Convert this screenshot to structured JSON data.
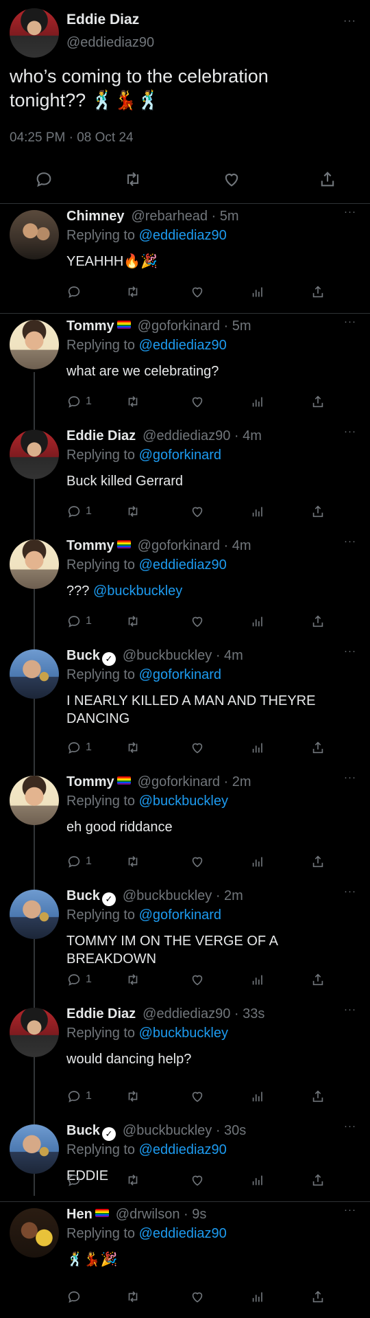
{
  "main": {
    "name": "Eddie Diaz",
    "handle": "@eddiediaz90",
    "text": "who’s coming to the celebration tonight?? 🕺💃🕺",
    "timestamp": "04:25 PM · 08 Oct 24",
    "more": "···"
  },
  "replies": [
    {
      "name": "Chimney",
      "badge": "",
      "handle": "@rebarhead · 5m",
      "replying_label": "Replying to",
      "replying_to": "@eddiediaz90",
      "text": "YEAHHH🔥🎉",
      "mention": "",
      "reply_count": ""
    },
    {
      "name": "Tommy",
      "badge": "flag",
      "handle": "@goforkinard · 5m",
      "replying_label": "Replying to",
      "replying_to": "@eddiediaz90",
      "text": "what are we celebrating?",
      "mention": "",
      "reply_count": "1"
    },
    {
      "name": "Eddie Diaz",
      "badge": "",
      "handle": "@eddiediaz90 · 4m",
      "replying_label": "Replying to",
      "replying_to": "@goforkinard",
      "text": "Buck killed Gerrard",
      "mention": "",
      "reply_count": "1"
    },
    {
      "name": "Tommy",
      "badge": "flag",
      "handle": "@goforkinard · 4m",
      "replying_label": "Replying to",
      "replying_to": "@eddiediaz90",
      "text": "???",
      "mention": "@buckbuckley",
      "reply_count": "1"
    },
    {
      "name": "Buck",
      "badge": "verified",
      "handle": "@buckbuckley · 4m",
      "replying_label": "Replying to",
      "replying_to": "@goforkinard",
      "text": "I NEARLY KILLED A MAN AND THEYRE DANCING",
      "mention": "",
      "reply_count": "1"
    },
    {
      "name": "Tommy",
      "badge": "flag",
      "handle": "@goforkinard · 2m",
      "replying_label": "Replying to",
      "replying_to": "@buckbuckley",
      "text": "eh good riddance",
      "mention": "",
      "reply_count": "1"
    },
    {
      "name": "Buck",
      "badge": "verified",
      "handle": "@buckbuckley · 2m",
      "replying_label": "Replying to",
      "replying_to": "@goforkinard",
      "text": "TOMMY IM ON THE VERGE OF A BREAKDOWN",
      "mention": "",
      "reply_count": "1"
    },
    {
      "name": "Eddie Diaz",
      "badge": "",
      "handle": "@eddiediaz90 · 33s",
      "replying_label": "Replying to",
      "replying_to": "@buckbuckley",
      "text": "would dancing help?",
      "mention": "",
      "reply_count": "1"
    },
    {
      "name": "Buck",
      "badge": "verified",
      "handle": "@buckbuckley · 30s",
      "replying_label": "Replying to",
      "replying_to": "@eddiediaz90",
      "text": "EDDIE",
      "mention": "",
      "reply_count": ""
    },
    {
      "name": "Hen",
      "badge": "flag",
      "handle": "@drwilson · 9s",
      "replying_label": "Replying to",
      "replying_to": "@eddiediaz90",
      "text": "🕺💃🎉",
      "mention": "",
      "reply_count": ""
    }
  ],
  "icons": {
    "reply": "reply-icon",
    "retweet": "retweet-icon",
    "like": "heart-icon",
    "views": "views-icon",
    "share": "share-icon",
    "verified": "verified-icon",
    "pride_flag": "pride-flag-icon",
    "check_glyph": "✓"
  },
  "colors": {
    "background": "#000000",
    "text": "#e7e9ea",
    "muted": "#71767b",
    "accent": "#1d9bf0",
    "divider": "#2f3336"
  }
}
